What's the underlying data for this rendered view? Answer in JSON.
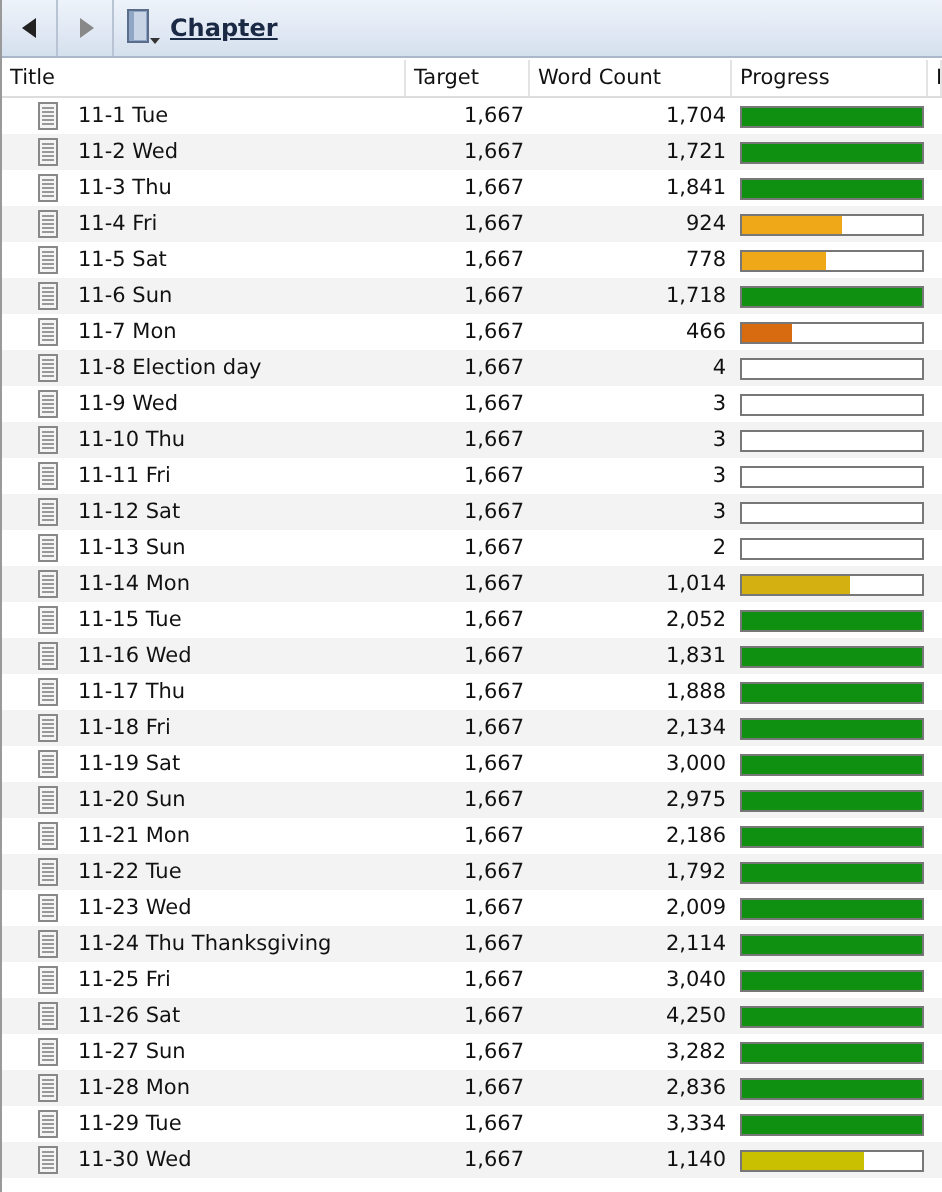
{
  "toolbar": {
    "title": "Chapter"
  },
  "columns": [
    "Title",
    "Target",
    "Word Count",
    "Progress",
    "I"
  ],
  "rows": [
    {
      "title": "11-1 Tue",
      "target": "1,667",
      "words": "1,704",
      "level": 1,
      "color": "#109010"
    },
    {
      "title": "11-2 Wed",
      "target": "1,667",
      "words": "1,721",
      "level": 1,
      "color": "#109010"
    },
    {
      "title": "11-3 Thu",
      "target": "1,667",
      "words": "1,841",
      "level": 1,
      "color": "#109010"
    },
    {
      "title": "11-4 Fri",
      "target": "1,667",
      "words": "924",
      "level": 0.55,
      "color": "#eea818"
    },
    {
      "title": "11-5 Sat",
      "target": "1,667",
      "words": "778",
      "level": 0.47,
      "color": "#eea818"
    },
    {
      "title": "11-6 Sun",
      "target": "1,667",
      "words": "1,718",
      "level": 1,
      "color": "#109010"
    },
    {
      "title": "11-7 Mon",
      "target": "1,667",
      "words": "466",
      "level": 0.28,
      "color": "#d86a10"
    },
    {
      "title": "11-8 Election day",
      "target": "1,667",
      "words": "4"
    },
    {
      "title": "11-9 Wed",
      "target": "1,667",
      "words": "3"
    },
    {
      "title": "11-10 Thu",
      "target": "1,667",
      "words": "3"
    },
    {
      "title": "11-11 Fri",
      "target": "1,667",
      "words": "3"
    },
    {
      "title": "11-12 Sat",
      "target": "1,667",
      "words": "3"
    },
    {
      "title": "11-13 Sun",
      "target": "1,667",
      "words": "2"
    },
    {
      "title": "11-14 Mon",
      "target": "1,667",
      "words": "1,014",
      "level": 0.6,
      "color": "#d4b010"
    },
    {
      "title": "11-15 Tue",
      "target": "1,667",
      "words": "2,052",
      "level": 1,
      "color": "#109010"
    },
    {
      "title": "11-16 Wed",
      "target": "1,667",
      "words": "1,831",
      "level": 1,
      "color": "#109010"
    },
    {
      "title": "11-17 Thu",
      "target": "1,667",
      "words": "1,888",
      "level": 1,
      "color": "#109010"
    },
    {
      "title": "11-18 Fri",
      "target": "1,667",
      "words": "2,134",
      "level": 1,
      "color": "#109010"
    },
    {
      "title": "11-19 Sat",
      "target": "1,667",
      "words": "3,000",
      "level": 1,
      "color": "#109010"
    },
    {
      "title": "11-20 Sun",
      "target": "1,667",
      "words": "2,975",
      "level": 1,
      "color": "#109010"
    },
    {
      "title": "11-21 Mon",
      "target": "1,667",
      "words": "2,186",
      "level": 1,
      "color": "#109010"
    },
    {
      "title": "11-22 Tue",
      "target": "1,667",
      "words": "1,792",
      "level": 1,
      "color": "#109010"
    },
    {
      "title": "11-23 Wed",
      "target": "1,667",
      "words": "2,009",
      "level": 1,
      "color": "#109010"
    },
    {
      "title": "11-24 Thu Thanksgiving",
      "target": "1,667",
      "words": "2,114",
      "level": 1,
      "color": "#109010"
    },
    {
      "title": "11-25 Fri",
      "target": "1,667",
      "words": "3,040",
      "level": 1,
      "color": "#109010"
    },
    {
      "title": "11-26 Sat",
      "target": "1,667",
      "words": "4,250",
      "level": 1,
      "color": "#109010"
    },
    {
      "title": "11-27 Sun",
      "target": "1,667",
      "words": "3,282",
      "level": 1,
      "color": "#109010"
    },
    {
      "title": "11-28 Mon",
      "target": "1,667",
      "words": "2,836",
      "level": 1,
      "color": "#109010"
    },
    {
      "title": "11-29 Tue",
      "target": "1,667",
      "words": "3,334",
      "level": 1,
      "color": "#109010"
    },
    {
      "title": "11-30 Wed",
      "target": "1,667",
      "words": "1,140",
      "level": 0.68,
      "color": "#c8c000"
    }
  ]
}
